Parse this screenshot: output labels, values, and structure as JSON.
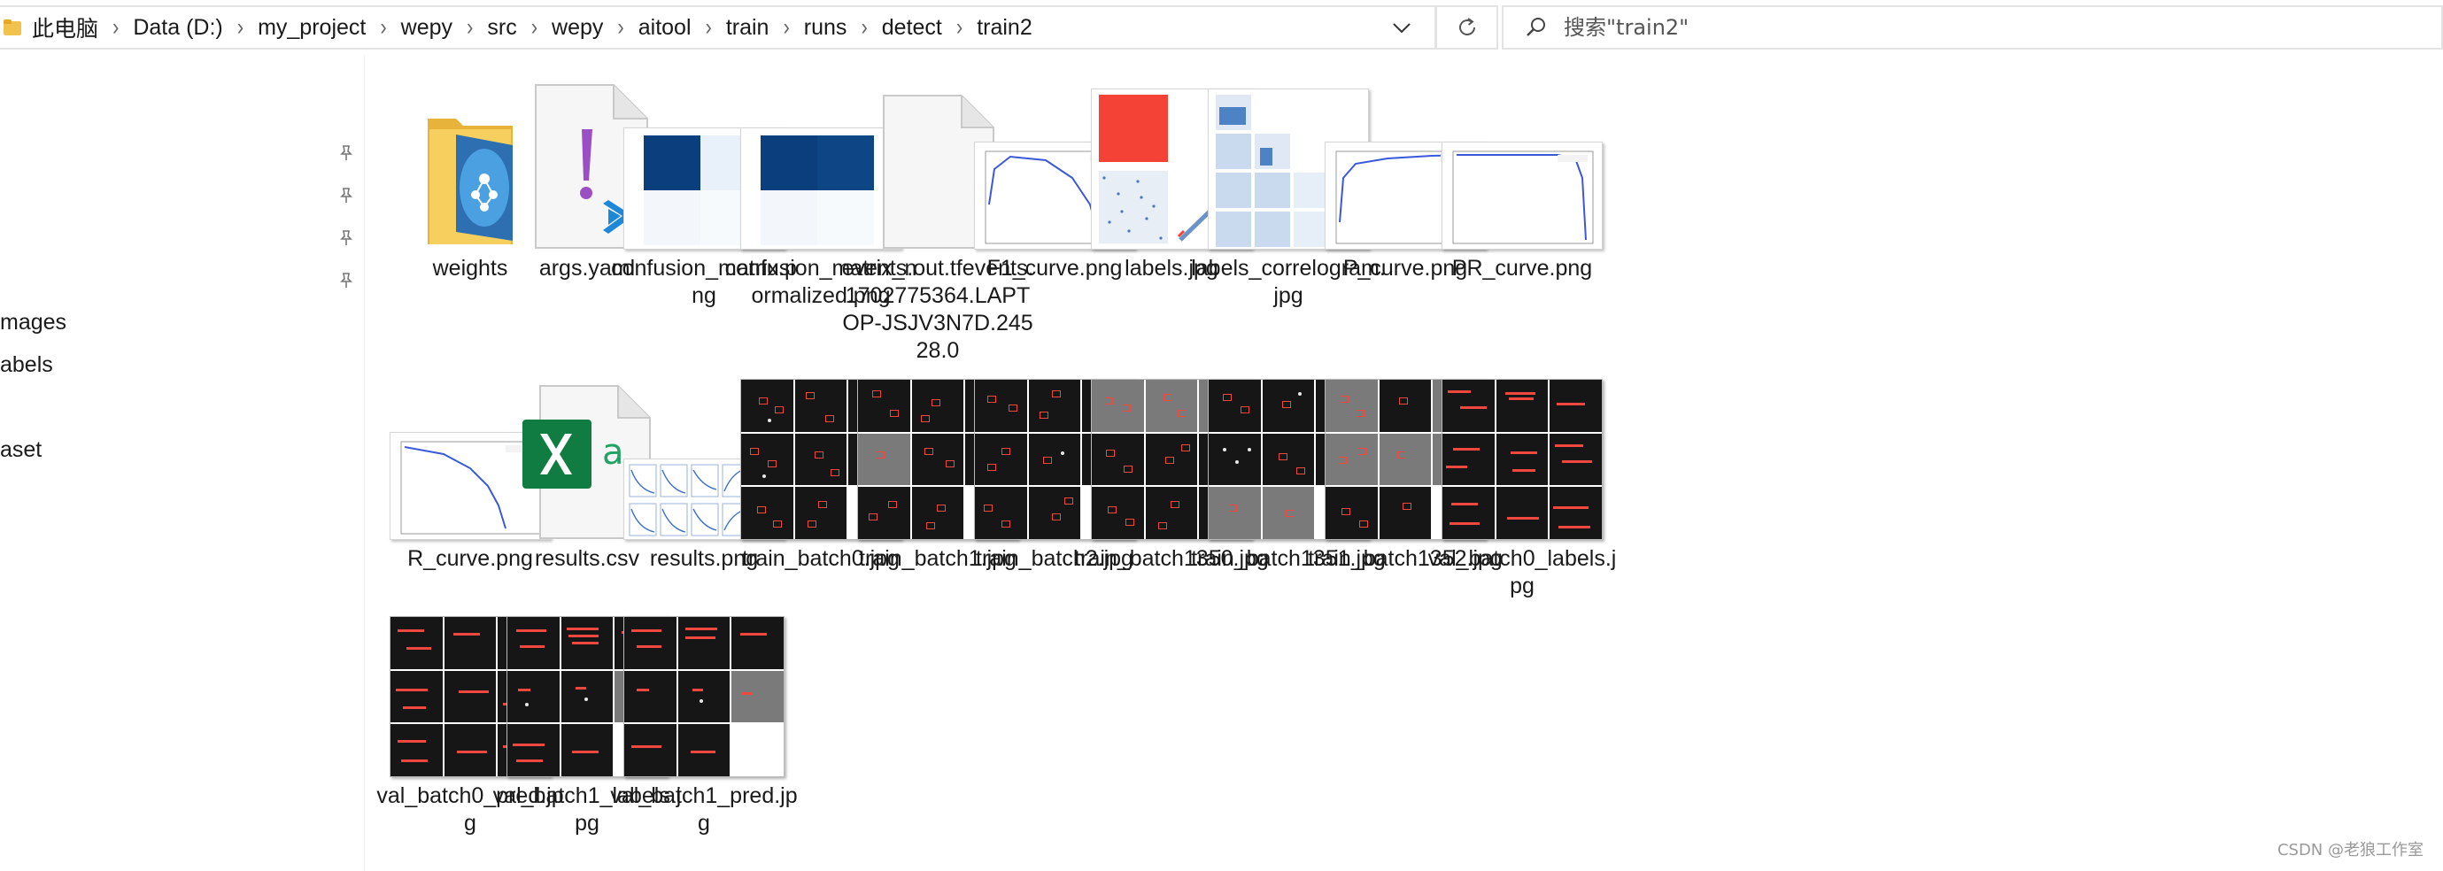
{
  "address_bar": {
    "crumbs": [
      "此电脑",
      "Data (D:)",
      "my_project",
      "wepy",
      "src",
      "wepy",
      "aitool",
      "train",
      "runs",
      "detect",
      "train2"
    ]
  },
  "search": {
    "placeholder": "搜索\"train2\""
  },
  "sidebar": {
    "items": [
      "mages",
      "abels",
      "aset"
    ]
  },
  "files": [
    {
      "name": "weights",
      "kind": "folder"
    },
    {
      "name": "args.yaml",
      "kind": "yaml"
    },
    {
      "name": "confusion_matrix.png",
      "kind": "confusion"
    },
    {
      "name": "confusion_matrix_normalized.png",
      "kind": "confusion"
    },
    {
      "name": "events.out.tfevents.1702775364.LAPTOP-JSJV3N7D.24528.0",
      "kind": "blank"
    },
    {
      "name": "F1_curve.png",
      "kind": "curve"
    },
    {
      "name": "labels.jpg",
      "kind": "labels"
    },
    {
      "name": "labels_correlogram.jpg",
      "kind": "correlogram"
    },
    {
      "name": "P_curve.png",
      "kind": "curve"
    },
    {
      "name": "PR_curve.png",
      "kind": "curve"
    },
    {
      "name": "R_curve.png",
      "kind": "curve"
    },
    {
      "name": "results.csv",
      "kind": "csv"
    },
    {
      "name": "results.png",
      "kind": "results"
    },
    {
      "name": "train_batch0.jpg",
      "kind": "batch"
    },
    {
      "name": "train_batch1.jpg",
      "kind": "batch"
    },
    {
      "name": "train_batch2.jpg",
      "kind": "batch"
    },
    {
      "name": "train_batch1350.jpg",
      "kind": "batch"
    },
    {
      "name": "train_batch1351.jpg",
      "kind": "batch"
    },
    {
      "name": "train_batch1352.jpg",
      "kind": "batch"
    },
    {
      "name": "val_batch0_labels.jpg",
      "kind": "batch"
    },
    {
      "name": "val_batch0_pred.jpg",
      "kind": "batch"
    },
    {
      "name": "val_batch1_labels.jpg",
      "kind": "batch"
    },
    {
      "name": "val_batch1_pred.jpg",
      "kind": "batch"
    }
  ],
  "watermark": "CSDN @老狼工作室",
  "colors": {
    "folder": "#f1c34d",
    "excel_green": "#107c41",
    "yaml_purple": "#9b4fc4",
    "vscode_blue": "#1e88d8",
    "plot_line": "#3b58d9",
    "matrix_dark": "#0b3e7c",
    "box_red": "#f0473e"
  }
}
